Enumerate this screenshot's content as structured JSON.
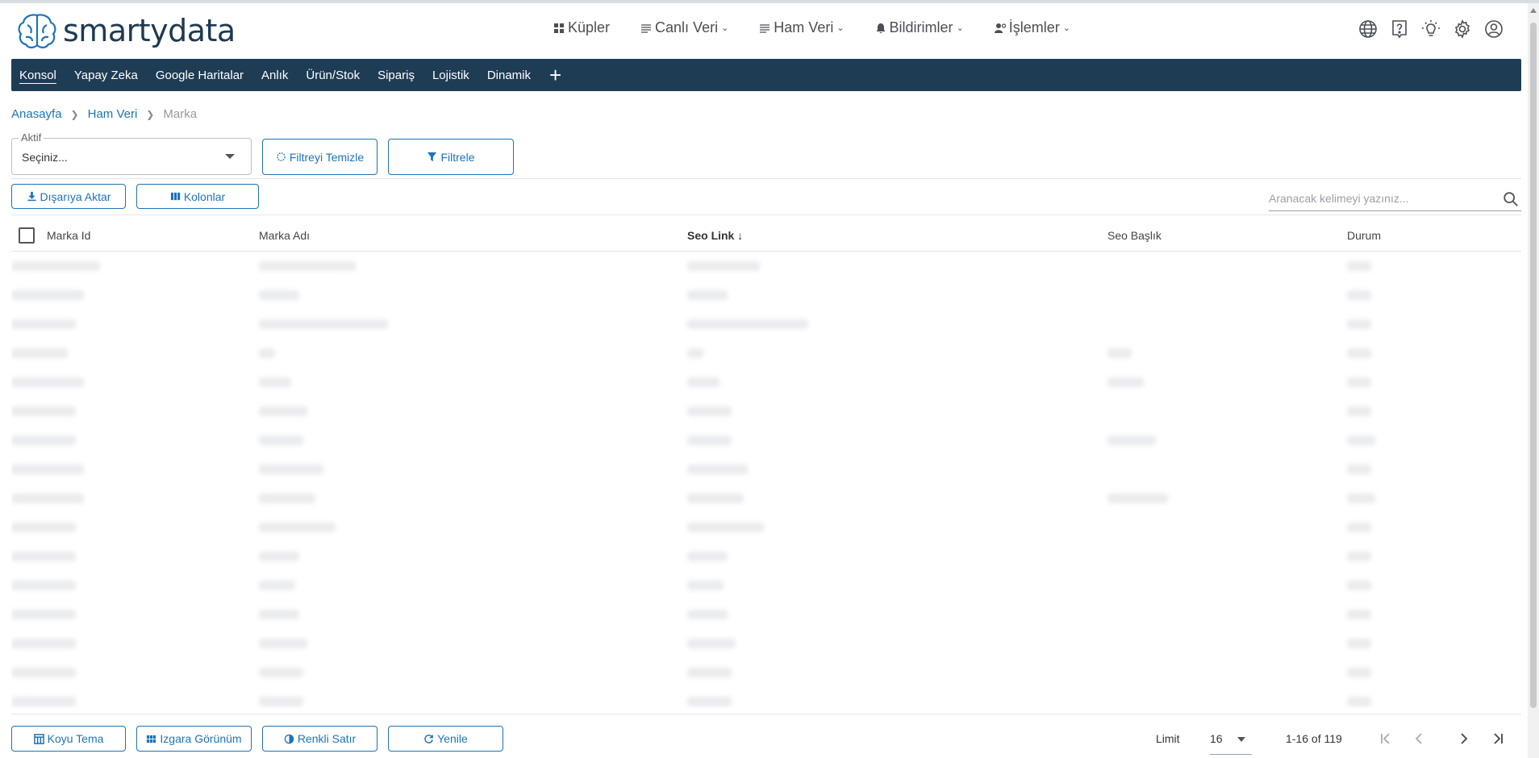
{
  "header": {
    "logo_text_light": "smarty",
    "logo_text_bold": "data",
    "nav": [
      {
        "label": "Küpler",
        "icon": "cubes-icon",
        "has_dropdown": false
      },
      {
        "label": "Canlı Veri",
        "icon": "list-icon",
        "has_dropdown": true
      },
      {
        "label": "Ham Veri",
        "icon": "list-icon",
        "has_dropdown": true
      },
      {
        "label": "Bildirimler",
        "icon": "bell-icon",
        "has_dropdown": true
      },
      {
        "label": "İşlemler",
        "icon": "user-gear-icon",
        "has_dropdown": true
      }
    ],
    "icons": [
      "globe-icon",
      "help-icon",
      "lightbulb-icon",
      "gear-icon",
      "account-icon"
    ]
  },
  "menubar": {
    "items": [
      "Konsol",
      "Yapay Zeka",
      "Google Haritalar",
      "Anlık",
      "Ürün/Stok",
      "Sipariş",
      "Lojistik",
      "Dinamik"
    ],
    "active": "Konsol",
    "add_icon": "plus-icon"
  },
  "breadcrumb": {
    "items": [
      "Anasayfa",
      "Ham Veri"
    ],
    "current": "Marka"
  },
  "filters": {
    "aktif_label": "Aktif",
    "aktif_value": "Seçiniz...",
    "clear_button": "Filtreyi Temizle",
    "filter_button": "Filtrele"
  },
  "toolbar": {
    "export_button": "Dışarıya Aktar",
    "columns_button": "Kolonlar",
    "search_placeholder": "Aranacak kelimeyi yazınız..."
  },
  "table": {
    "columns": [
      "Marka Id",
      "Marka Adı",
      "Seo Link",
      "Seo Başlık",
      "Durum"
    ],
    "sorted_column": "Seo Link",
    "sort_direction": "desc",
    "row_count": 16,
    "rows_blurred": true
  },
  "footer": {
    "buttons": [
      "Koyu Tema",
      "Izgara Görünüm",
      "Renkli Satır",
      "Yenile"
    ],
    "limit_label": "Limit",
    "limit_value": "16",
    "range_text": "1-16 of 119"
  },
  "colors": {
    "menubar_bg": "#1f3c55",
    "accent": "#1e73b8",
    "logo": "#1e3a52"
  }
}
